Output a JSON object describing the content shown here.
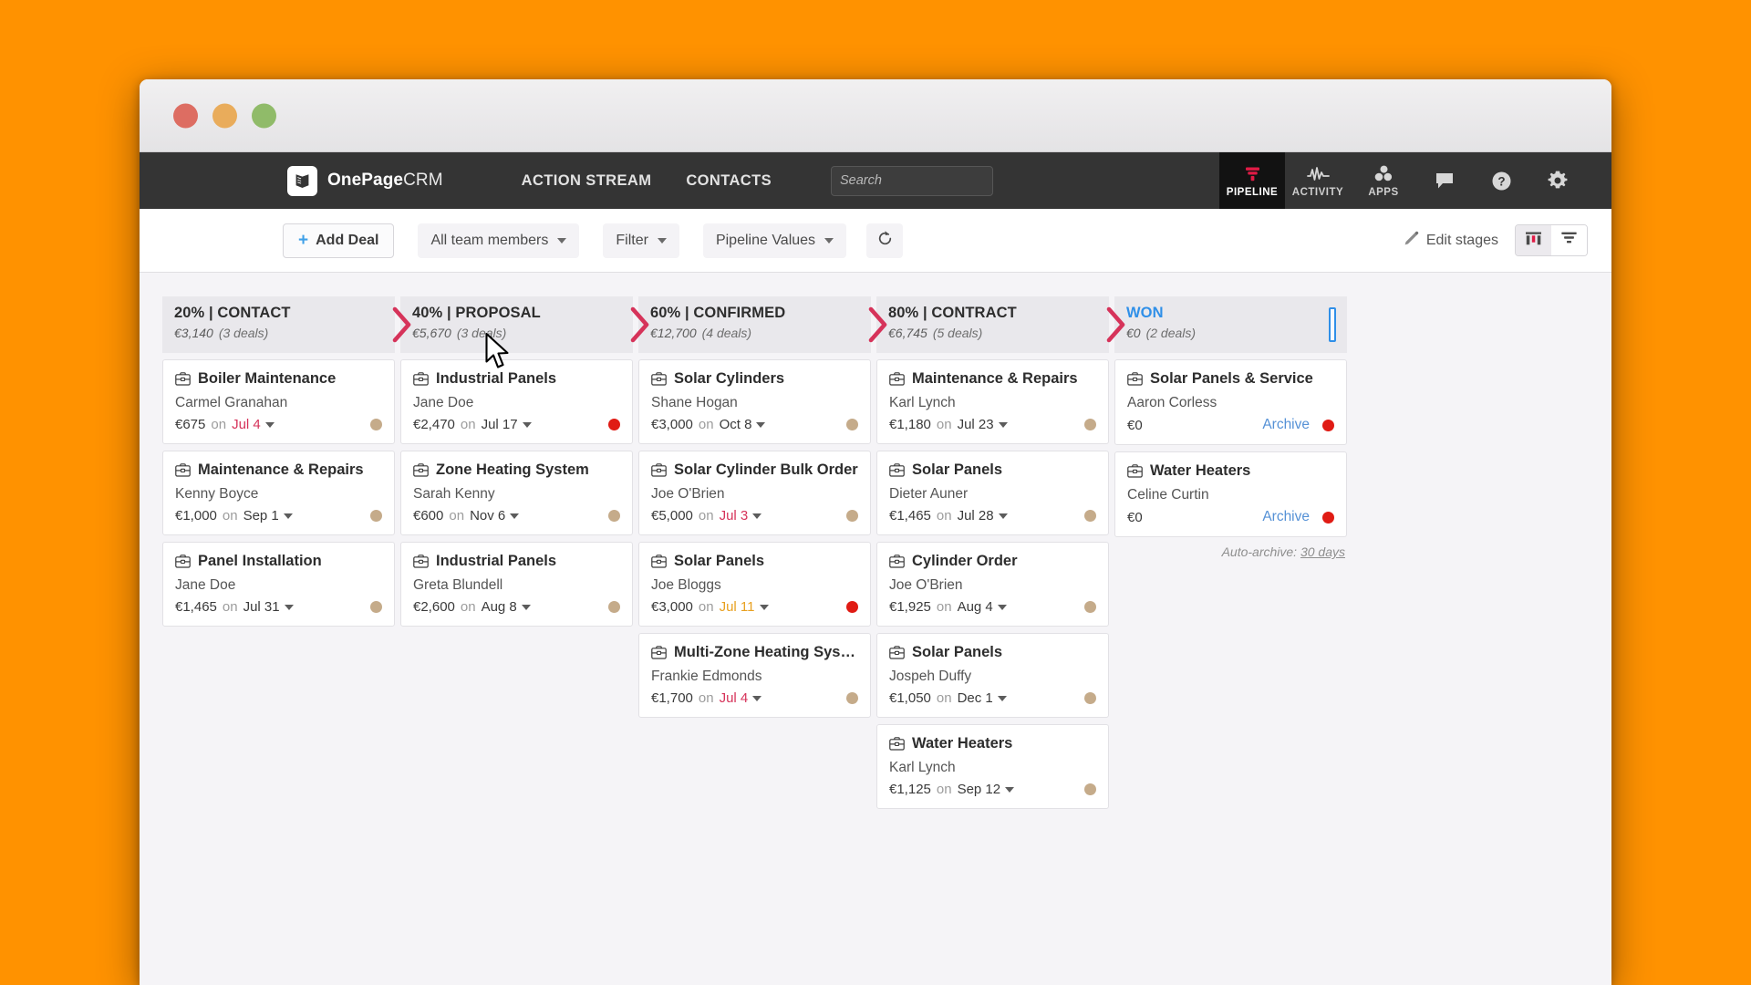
{
  "window": {
    "traffic_lights": [
      "close",
      "minimize",
      "maximize"
    ]
  },
  "topnav": {
    "brand_bold": "OnePage",
    "brand_light": "CRM",
    "brand_logo_icon": "onepagecrm-book-logo-icon",
    "links": [
      {
        "label": "ACTION STREAM",
        "name": "nav-action-stream"
      },
      {
        "label": "CONTACTS",
        "name": "nav-contacts"
      }
    ],
    "search": {
      "placeholder": "Search",
      "value": "",
      "caret_icon": "chevron-down-icon"
    },
    "icons": [
      {
        "label": "PIPELINE",
        "icon": "funnel-icon",
        "active": true
      },
      {
        "label": "ACTIVITY",
        "icon": "pulse-wave-icon",
        "active": false
      },
      {
        "label": "APPS",
        "icon": "apps-bubbles-icon",
        "active": false
      },
      {
        "label": "",
        "icon": "chat-bubble-icon",
        "active": false
      },
      {
        "label": "",
        "icon": "help-question-icon",
        "active": false
      },
      {
        "label": "",
        "icon": "gear-icon",
        "active": false
      }
    ]
  },
  "toolbar": {
    "add_deal_label": "Add Deal",
    "add_deal_icon": "plus-icon",
    "team_filter_label": "All team members",
    "filter_label": "Filter",
    "pipeline_values_label": "Pipeline Values",
    "refresh_icon": "refresh-icon",
    "edit_stages_label": "Edit stages",
    "edit_stages_icon": "pencil-icon",
    "view_kanban_icon": "kanban-columns-icon",
    "view_funnel_icon": "funnel-view-icon",
    "view_selected": "funnel"
  },
  "board": {
    "auto_archive_prefix": "Auto-archive:",
    "auto_archive_value": "30 days",
    "stages": [
      {
        "title": "20% | CONTACT",
        "amount": "€3,140",
        "deals_count": "(3 deals)",
        "won": false,
        "deals": [
          {
            "title": "Boiler Maintenance",
            "contact": "Carmel Granahan",
            "amount": "€675",
            "on": "on",
            "date": "Jul 4",
            "date_state": "overdue",
            "dot": "tan"
          },
          {
            "title": "Maintenance & Repairs",
            "contact": "Kenny Boyce",
            "amount": "€1,000",
            "on": "on",
            "date": "Sep 1",
            "date_state": "normal",
            "dot": "tan"
          },
          {
            "title": "Panel Installation",
            "contact": "Jane Doe",
            "amount": "€1,465",
            "on": "on",
            "date": "Jul 31",
            "date_state": "normal",
            "dot": "tan"
          }
        ]
      },
      {
        "title": "40% | PROPOSAL",
        "amount": "€5,670",
        "deals_count": "(3 deals)",
        "won": false,
        "deals": [
          {
            "title": "Industrial Panels",
            "contact": "Jane Doe",
            "amount": "€2,470",
            "on": "on",
            "date": "Jul 17",
            "date_state": "normal",
            "dot": "red"
          },
          {
            "title": "Zone Heating System",
            "contact": "Sarah Kenny",
            "amount": "€600",
            "on": "on",
            "date": "Nov 6",
            "date_state": "normal",
            "dot": "tan"
          },
          {
            "title": "Industrial Panels",
            "contact": "Greta Blundell",
            "amount": "€2,600",
            "on": "on",
            "date": "Aug 8",
            "date_state": "normal",
            "dot": "tan"
          }
        ]
      },
      {
        "title": "60% | CONFIRMED",
        "amount": "€12,700",
        "deals_count": "(4 deals)",
        "won": false,
        "deals": [
          {
            "title": "Solar Cylinders",
            "contact": "Shane Hogan",
            "amount": "€3,000",
            "on": "on",
            "date": "Oct 8",
            "date_state": "normal",
            "dot": "tan"
          },
          {
            "title": "Solar Cylinder Bulk Order",
            "contact": "Joe O'Brien",
            "amount": "€5,000",
            "on": "on",
            "date": "Jul 3",
            "date_state": "overdue",
            "dot": "tan"
          },
          {
            "title": "Solar Panels",
            "contact": "Joe Bloggs",
            "amount": "€3,000",
            "on": "on",
            "date": "Jul 11",
            "date_state": "warn",
            "dot": "red"
          },
          {
            "title": "Multi-Zone Heating Syst…",
            "contact": "Frankie Edmonds",
            "amount": "€1,700",
            "on": "on",
            "date": "Jul 4",
            "date_state": "overdue",
            "dot": "tan"
          }
        ]
      },
      {
        "title": "80% | CONTRACT",
        "amount": "€6,745",
        "deals_count": "(5 deals)",
        "won": false,
        "deals": [
          {
            "title": "Maintenance & Repairs",
            "contact": "Karl Lynch",
            "amount": "€1,180",
            "on": "on",
            "date": "Jul 23",
            "date_state": "normal",
            "dot": "tan"
          },
          {
            "title": "Solar Panels",
            "contact": "Dieter Auner",
            "amount": "€1,465",
            "on": "on",
            "date": "Jul 28",
            "date_state": "normal",
            "dot": "tan"
          },
          {
            "title": "Cylinder Order",
            "contact": "Joe O'Brien",
            "amount": "€1,925",
            "on": "on",
            "date": "Aug 4",
            "date_state": "normal",
            "dot": "tan"
          },
          {
            "title": "Solar Panels",
            "contact": "Jospeh Duffy",
            "amount": "€1,050",
            "on": "on",
            "date": "Dec 1",
            "date_state": "normal",
            "dot": "tan"
          },
          {
            "title": "Water Heaters",
            "contact": "Karl Lynch",
            "amount": "€1,125",
            "on": "on",
            "date": "Sep 12",
            "date_state": "normal",
            "dot": "tan"
          }
        ]
      },
      {
        "title": "WON",
        "amount": "€0",
        "deals_count": "(2 deals)",
        "won": true,
        "deals": [
          {
            "title": "Solar Panels & Service",
            "contact": "Aaron Corless",
            "amount": "€0",
            "archive_label": "Archive",
            "dot": "red"
          },
          {
            "title": "Water Heaters",
            "contact": "Celine Curtin",
            "amount": "€0",
            "archive_label": "Archive",
            "dot": "red"
          }
        ]
      }
    ]
  },
  "colors": {
    "desktop_background": "#FF9200",
    "navbar": "#343434",
    "accent_red": "#d6335a",
    "won_blue": "#2f8fe8",
    "dot_tan": "#c5ab8a",
    "dot_red": "#e01b14"
  }
}
